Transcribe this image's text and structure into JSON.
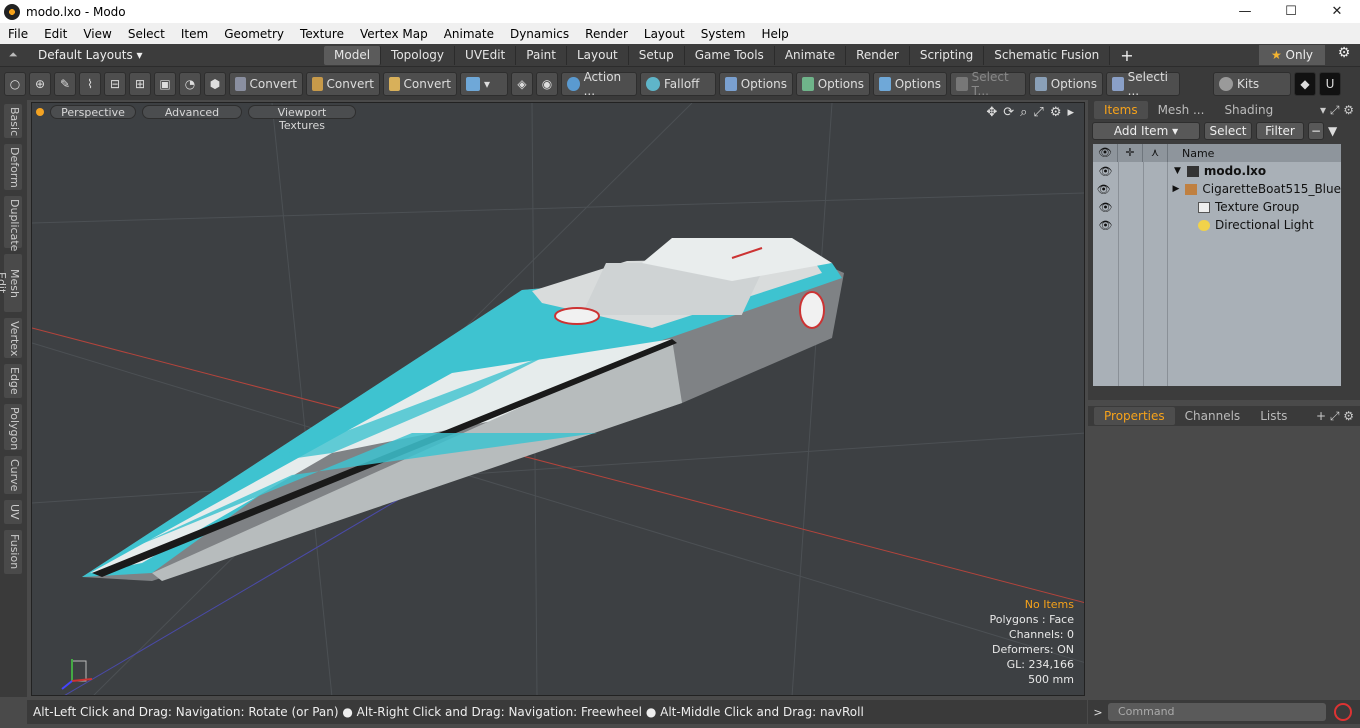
{
  "window": {
    "title": "modo.lxo - Modo",
    "minimize": "—",
    "maximize": "☐",
    "close": "✕"
  },
  "menu": [
    "File",
    "Edit",
    "View",
    "Select",
    "Item",
    "Geometry",
    "Texture",
    "Vertex Map",
    "Animate",
    "Dynamics",
    "Render",
    "Layout",
    "System",
    "Help"
  ],
  "layouts": {
    "label": "Default Layouts ▾",
    "tabs": [
      "Model",
      "Topology",
      "UVEdit",
      "Paint",
      "Layout",
      "Setup",
      "Game Tools",
      "Animate",
      "Render",
      "Scripting",
      "Schematic Fusion"
    ],
    "active": "Model",
    "only": "Only"
  },
  "toolbar": {
    "convert1": "Convert",
    "convert2": "Convert",
    "convert3": "Convert",
    "action": "Action ...",
    "falloff": "Falloff",
    "options1": "Options",
    "options2": "Options",
    "options3": "Options",
    "options4": "Options",
    "select_t": "Select T...",
    "selecti": "Selecti ...",
    "kits": "Kits"
  },
  "left_tabs": [
    "Basic",
    "Deform",
    "Duplicate",
    "Mesh Edit",
    "Vertex",
    "Edge",
    "Polygon",
    "Curve",
    "UV",
    "Fusion"
  ],
  "viewport": {
    "perspective": "Perspective",
    "advanced": "Advanced",
    "textures": "Viewport Textures",
    "info": {
      "no_items": "No Items",
      "polygons": "Polygons : Face",
      "channels": "Channels: 0",
      "deformers": "Deformers: ON",
      "gl": "GL: 234,166",
      "scale": "500 mm"
    }
  },
  "status": "Alt-Left Click and Drag: Navigation: Rotate (or Pan) ● Alt-Right Click and Drag: Navigation: Freewheel ● Alt-Middle Click and Drag: navRoll",
  "items_panel": {
    "tabs": [
      "Items",
      "Mesh ...",
      "Shading"
    ],
    "add_item": "Add Item",
    "select": "Select",
    "filter": "Filter",
    "name_col": "Name",
    "rows": [
      {
        "name": "modo.lxo",
        "bold": true
      },
      {
        "name": "CigaretteBoat515_Blue"
      },
      {
        "name": "Texture Group"
      },
      {
        "name": "Directional Light"
      }
    ]
  },
  "props_panel": {
    "tabs": [
      "Properties",
      "Channels",
      "Lists"
    ]
  },
  "command": {
    "placeholder": "Command"
  },
  "colors": {
    "accent": "#f6a21a",
    "boat_blue": "#3ec3d0"
  }
}
